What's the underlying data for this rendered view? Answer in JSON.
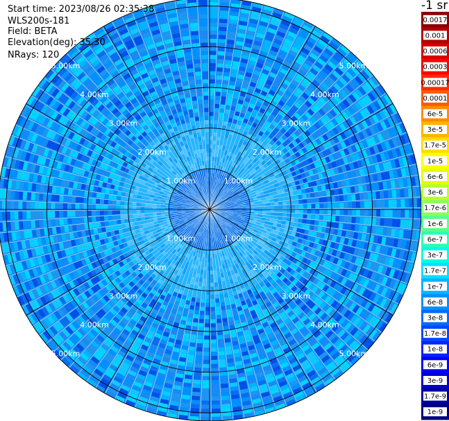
{
  "info": {
    "start_time": "Start time: 2023/08/26 02:35:38",
    "instrument": "WLS200s-181",
    "field": "Field: BETA",
    "elevation": "Elevation(deg): 35.30",
    "nrays": "NRays: 120"
  },
  "chart_data": {
    "type": "polar-ppi",
    "range_unit": "km",
    "max_range_km": 5.2,
    "n_rays": 120,
    "ring_labels": [
      "1.00km",
      "2.00km",
      "3.00km",
      "4.00km",
      "5.00km"
    ],
    "ring_ranges_km": [
      1,
      2,
      3,
      4,
      5
    ],
    "spoke_angles_deg": [
      0,
      30,
      60,
      90,
      120,
      150,
      180,
      210,
      240,
      270,
      300,
      330
    ],
    "colorbar": {
      "title": "-1 sr",
      "labels": [
        "0.0017",
        "0.001",
        "0.0006",
        "0.0003",
        "0.00017",
        "0.0001",
        "6e-5",
        "3e-5",
        "1.7e-5",
        "1e-5",
        "6e-6",
        "3e-6",
        "1.7e-6",
        "1e-6",
        "6e-7",
        "3e-7",
        "1.7e-7",
        "1e-7",
        "6e-8",
        "3e-8",
        "1.7e-8",
        "1e-8",
        "6e-9",
        "3e-9",
        "1.7e-9",
        "1e-9"
      ],
      "colors": [
        "#8b0000",
        "#b40000",
        "#d80000",
        "#ff0000",
        "#ff2a00",
        "#ff5a00",
        "#ff8c00",
        "#ffb400",
        "#ffdc00",
        "#ffff00",
        "#e4ff00",
        "#b8ff2a",
        "#8cff5a",
        "#5aff8c",
        "#2affb8",
        "#00ffe0",
        "#00e0ff",
        "#00b4ff",
        "#0090ff",
        "#006cff",
        "#0048ff",
        "#0024ff",
        "#0000ff",
        "#0000d0",
        "#0000a0",
        "#000080"
      ]
    }
  }
}
